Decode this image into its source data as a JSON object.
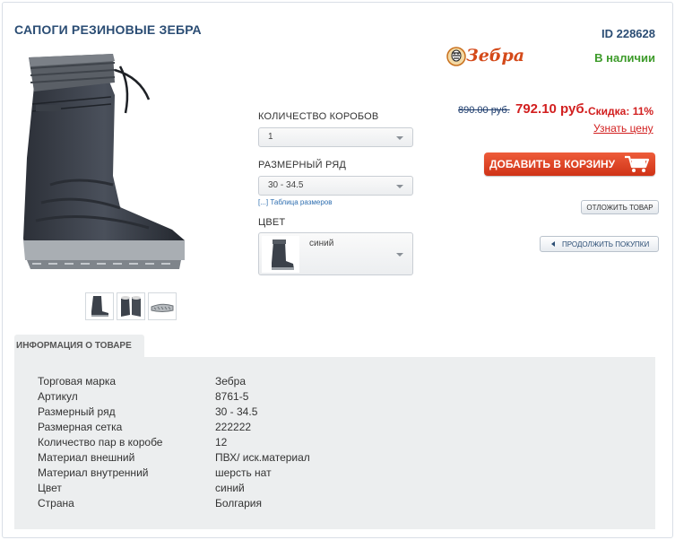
{
  "product": {
    "title": "САПОГИ РЕЗИНОВЫЕ ЗЕБРА",
    "id_label": "ID 228628",
    "brand_logo_text": "Зебра",
    "availability": "В наличии"
  },
  "pricing": {
    "old_price": "890.00 руб.",
    "new_price": "792.10 руб.",
    "discount_label": "Скидка:",
    "discount_value": "11%",
    "price_link": "Узнать цену"
  },
  "actions": {
    "add_to_cart": "ДОБАВИТЬ В КОРЗИНУ",
    "defer": "ОТЛОЖИТЬ ТОВАР",
    "continue": "ПРОДОЛЖИТЬ ПОКУПКИ"
  },
  "options": {
    "boxes_label": "КОЛИЧЕСТВО КОРОБОВ",
    "boxes_value": "1",
    "size_label": "РАЗМЕРНЫЙ РЯД",
    "size_value": "30 - 34.5",
    "size_table_link": "[...] Таблица размеров",
    "color_label": "ЦВЕТ",
    "color_value": "синий"
  },
  "info": {
    "tab_title": "ИНФОРМАЦИЯ О ТОВАРЕ",
    "rows": [
      {
        "label": "Торговая марка",
        "value": "Зебра"
      },
      {
        "label": "Артикул",
        "value": "8761-5"
      },
      {
        "label": "Размерный ряд",
        "value": "30 - 34.5"
      },
      {
        "label": "Размерная сетка",
        "value": "222222"
      },
      {
        "label": "Количество пар в коробе",
        "value": "12"
      },
      {
        "label": "Материал внешний",
        "value": "ПВХ/ иск.материал"
      },
      {
        "label": "Материал внутренний",
        "value": "шерсть нат"
      },
      {
        "label": "Цвет",
        "value": "синий"
      },
      {
        "label": "Страна",
        "value": "Болгария"
      }
    ]
  },
  "colors": {
    "title": "#2b4d74",
    "in_stock": "#3d9b2a",
    "price": "#d21f1f",
    "cart_button": "#e0441f"
  },
  "icons": [
    "brand-logo",
    "cart-icon",
    "back-arrow-icon",
    "chevron-down-icon"
  ]
}
